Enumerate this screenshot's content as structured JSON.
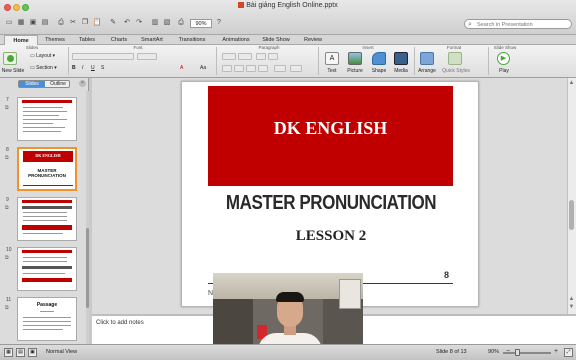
{
  "window": {
    "title": "Bài giảng English Online.pptx"
  },
  "toolbar": {
    "zoom": "90%",
    "search_placeholder": "Search in Presentation"
  },
  "ribbon_tabs": [
    "Home",
    "Themes",
    "Tables",
    "Charts",
    "SmartArt",
    "Transitions",
    "Animations",
    "Slide Show",
    "Review"
  ],
  "ribbon": {
    "group_labels": [
      "Slides",
      "Font",
      "Paragraph",
      "Insert",
      "Format",
      "Slide Show"
    ],
    "new_slide": "New Slide",
    "layout": "Layout",
    "section": "Section",
    "text": "Text",
    "picture": "Picture",
    "shape": "Shape",
    "media": "Media",
    "arrange": "Arrange",
    "quick_styles": "Quick Styles",
    "play": "Play"
  },
  "left_panel": {
    "tabs": [
      "Slides",
      "Outline"
    ],
    "thumbnails": [
      {
        "number": "7"
      },
      {
        "number": "8",
        "band": "DK ENGLISH",
        "title": "MASTER PRONUNCIATION",
        "selected": true
      },
      {
        "number": "9"
      },
      {
        "number": "10"
      },
      {
        "number": "11",
        "title": "Passage"
      }
    ]
  },
  "slide": {
    "brand": "DK ENGLISH",
    "title": "MASTER PRONUNCIATION",
    "subtitle": "LESSON 2",
    "page_number": "8"
  },
  "notes": {
    "placeholder": "Click to add notes"
  },
  "status": {
    "view": "Normal View",
    "slide_position": "Slide 8 of 13",
    "zoom": "90%"
  },
  "colors": {
    "brand_red": "#c00000",
    "selection": "#f0932b",
    "tab_active": "#4a8fd8"
  }
}
